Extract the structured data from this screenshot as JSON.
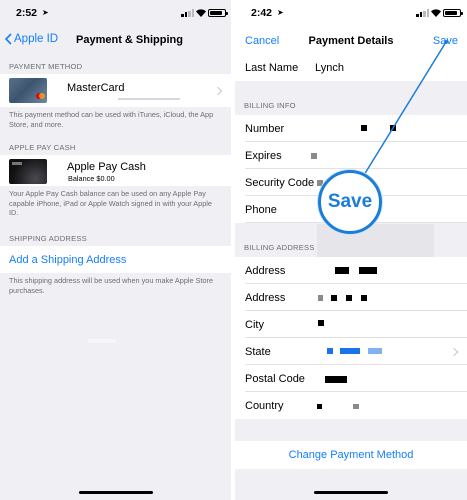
{
  "left": {
    "status": {
      "time": "2:52"
    },
    "nav": {
      "back_label": "Apple ID",
      "title": "Payment & Shipping"
    },
    "payment_method": {
      "header": "PAYMENT METHOD",
      "card_name": "MasterCard",
      "footer": "This payment method can be used with iTunes, iCloud, the App Store, and more."
    },
    "apple_pay_cash": {
      "header": "APPLE PAY CASH",
      "title": "Apple Pay Cash",
      "balance": "Balance $0.00",
      "footer": "Your Apple Pay Cash balance can be used on any Apple Pay capable iPhone, iPad or Apple Watch signed in with your Apple ID."
    },
    "shipping": {
      "header": "SHIPPING ADDRESS",
      "add_label": "Add a Shipping Address",
      "footer": "This shipping address will be used when you make Apple Store purchases."
    }
  },
  "right": {
    "status": {
      "time": "2:42"
    },
    "nav": {
      "cancel_label": "Cancel",
      "title": "Payment Details",
      "save_label": "Save"
    },
    "last_name": {
      "label": "Last Name",
      "value": "Lynch"
    },
    "billing_info": {
      "header": "BILLING INFO",
      "fields": [
        "Number",
        "Expires",
        "Security Code",
        "Phone"
      ]
    },
    "billing_address": {
      "header": "BILLING ADDRESS",
      "fields": [
        "Address",
        "Address",
        "City",
        "State",
        "Postal Code",
        "Country"
      ]
    },
    "callout_label": "Save",
    "change_label": "Change Payment Method"
  },
  "colors": {
    "accent": "#147efb",
    "callout": "#1a7ed9",
    "background": "#efeff4"
  }
}
